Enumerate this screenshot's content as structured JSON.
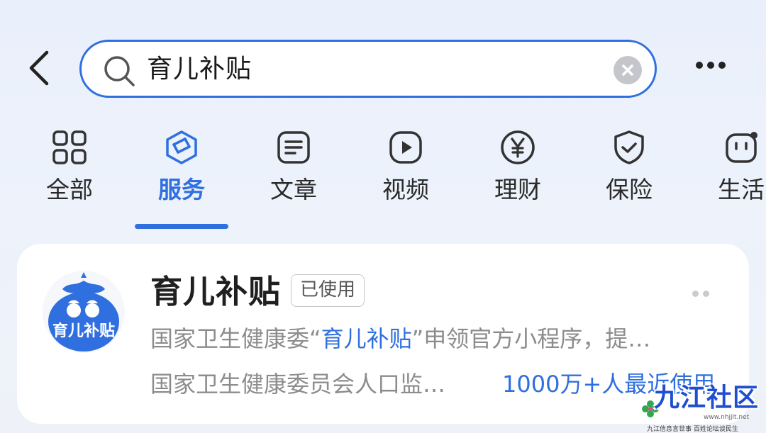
{
  "search": {
    "query": "育儿补贴"
  },
  "tabs": [
    {
      "label": "全部",
      "icon": "grid-icon"
    },
    {
      "label": "服务",
      "icon": "service-cube-icon"
    },
    {
      "label": "文章",
      "icon": "article-icon"
    },
    {
      "label": "视频",
      "icon": "play-icon"
    },
    {
      "label": "理财",
      "icon": "yen-icon"
    },
    {
      "label": "保险",
      "icon": "shield-check-icon"
    },
    {
      "label": "生活",
      "icon": "life-face-icon"
    }
  ],
  "active_tab": "服务",
  "result": {
    "title": "育儿补贴",
    "badge": "已使用",
    "logo_text": "育儿补贴",
    "desc_prefix": "国家卫生健康委“",
    "desc_highlight": "育儿补贴",
    "desc_suffix": "”申领官方小程序，提…",
    "owner": "国家卫生健康委员会人口监…",
    "users": "1000万+人最近使用"
  },
  "watermark": {
    "name": "九江社区",
    "url": "www.nhjjlt.net",
    "slogan": "九江信息言世事  百姓论坛谈民生"
  },
  "colors": {
    "accent": "#2f6fdf",
    "background": "#eaf0fb",
    "card": "#ffffff"
  }
}
